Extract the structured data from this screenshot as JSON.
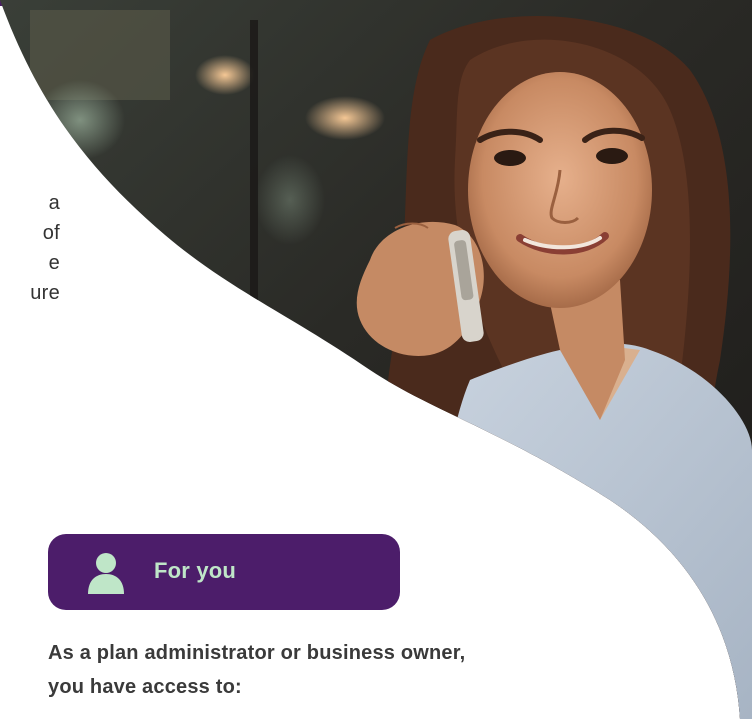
{
  "header": {
    "strip_color": "#4b1f63"
  },
  "left_text_lines": [
    "a",
    "of",
    "e",
    "ure"
  ],
  "for_you_button": {
    "label": "For you",
    "icon": "person-icon",
    "background": "#4c1d6a",
    "accent": "#bfe6c8"
  },
  "description": {
    "line1": "As a plan administrator or business owner,",
    "line2": "you have access to:"
  },
  "photo": {
    "icon": "woman-on-phone-photo"
  }
}
